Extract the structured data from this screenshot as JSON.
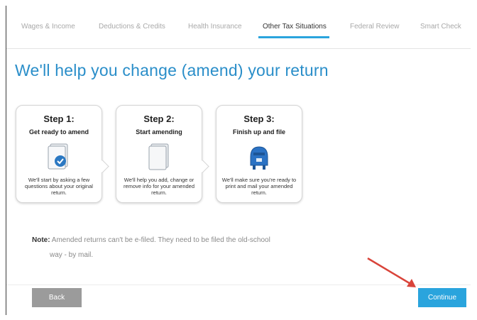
{
  "nav": {
    "tabs": [
      {
        "label": "Wages & Income"
      },
      {
        "label": "Deductions & Credits"
      },
      {
        "label": "Health Insurance"
      },
      {
        "label": "Other Tax Situations"
      },
      {
        "label": "Federal Review"
      },
      {
        "label": "Smart Check"
      }
    ],
    "active_tab": "Other Tax Situations"
  },
  "page": {
    "title": "We'll help you change (amend) your return"
  },
  "steps": [
    {
      "title": "Step 1:",
      "subtitle": "Get ready to amend",
      "icon": "document-check-icon",
      "description": "We'll start by asking a few questions about your original return."
    },
    {
      "title": "Step 2:",
      "subtitle": "Start amending",
      "icon": "blank-document-icon",
      "description": "We'll help you add, change or remove info for your amended return."
    },
    {
      "title": "Step 3:",
      "subtitle": "Finish up and file",
      "icon": "mailbox-icon",
      "description": "We'll make sure you're ready to print and mail your amended return."
    }
  ],
  "note": {
    "label": "Note:",
    "text": "Amended returns can't be e-filed. They need to be filed the old-school",
    "continuation": "way - by mail."
  },
  "footer": {
    "back_label": "Back",
    "continue_label": "Continue"
  },
  "colors": {
    "accent": "#2aa4dd",
    "title": "#2a8ec9",
    "back_button": "#9b9b9b",
    "arrow": "#d9443a"
  }
}
